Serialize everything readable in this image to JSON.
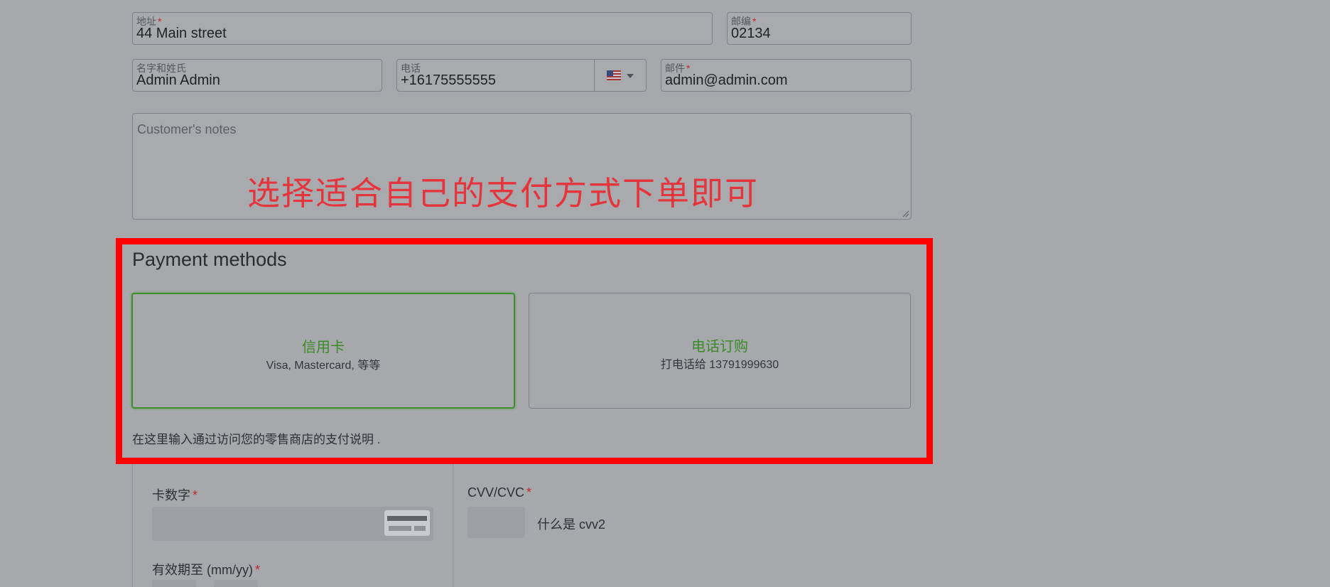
{
  "form": {
    "address": {
      "label": "地址",
      "required_mark": "*",
      "value": "44 Main street"
    },
    "zip": {
      "label": "邮编",
      "required_mark": "*",
      "value": "02134"
    },
    "name": {
      "label": "名字和姓氏",
      "value": "Admin Admin"
    },
    "phone": {
      "label": "电话",
      "value": "+16175555555",
      "country_icon": "us-flag-icon"
    },
    "email": {
      "label": "邮件",
      "required_mark": "*",
      "value": "admin@admin.com"
    },
    "notes": {
      "placeholder": "Customer's notes"
    }
  },
  "annotation": {
    "text": "选择适合自己的支付方式下单即可",
    "color": "#e4343c"
  },
  "highlight": {
    "color": "#ff0000"
  },
  "payment": {
    "title": "Payment methods",
    "methods": [
      {
        "name": "信用卡",
        "description": "Visa, Mastercard, 等等",
        "selected": true
      },
      {
        "name": "电话订购",
        "description": "打电话给 13791999630",
        "selected": false
      }
    ],
    "note": "在这里输入通过访问您的零售商店的支付说明 ."
  },
  "card_form": {
    "card_number": {
      "label": "卡数字",
      "required_mark": "*",
      "icon": "credit-card-icon"
    },
    "cvv": {
      "label": "CVV/CVC",
      "required_mark": "*",
      "help": "什么是 cvv2"
    },
    "expiry": {
      "label": "有效期至 (mm/yy)",
      "required_mark": "*"
    }
  },
  "colors": {
    "accent_green": "#3c8a2a",
    "required_red": "#c2272d"
  }
}
